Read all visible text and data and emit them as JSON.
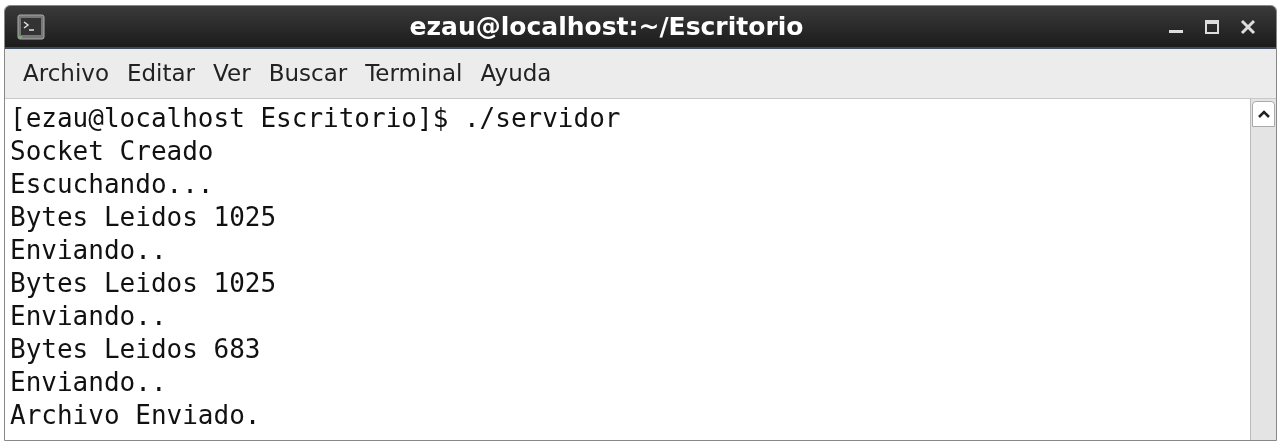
{
  "window": {
    "title": "ezau@localhost:~/Escritorio"
  },
  "menu": [
    "Archivo",
    "Editar",
    "Ver",
    "Buscar",
    "Terminal",
    "Ayuda"
  ],
  "terminal": {
    "lines": [
      "[ezau@localhost Escritorio]$ ./servidor",
      "Socket Creado",
      "Escuchando...",
      "Bytes Leidos 1025",
      "Enviando..",
      "Bytes Leidos 1025",
      "Enviando..",
      "Bytes Leidos 683",
      "Enviando..",
      "Archivo Enviado."
    ]
  }
}
